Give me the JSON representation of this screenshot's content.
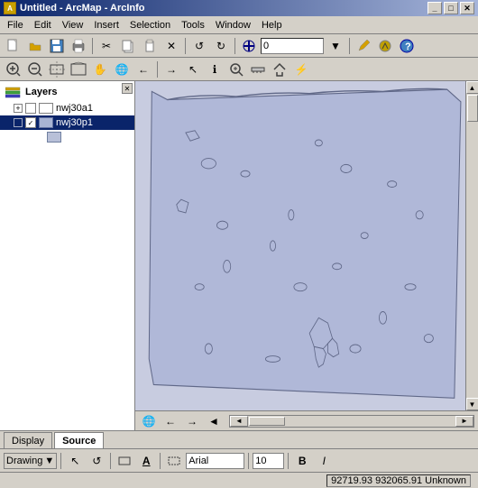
{
  "window": {
    "title": "Untitled - ArcMap - ArcInfo",
    "icon": "A"
  },
  "titlebar": {
    "buttons": {
      "minimize": "_",
      "maximize": "□",
      "close": "✕"
    }
  },
  "menubar": {
    "items": [
      {
        "label": "File",
        "id": "file"
      },
      {
        "label": "Edit",
        "id": "edit"
      },
      {
        "label": "View",
        "id": "view"
      },
      {
        "label": "Insert",
        "id": "insert"
      },
      {
        "label": "Selection",
        "id": "selection"
      },
      {
        "label": "Tools",
        "id": "tools"
      },
      {
        "label": "Window",
        "id": "window"
      },
      {
        "label": "Help",
        "id": "help"
      }
    ]
  },
  "toolbar1": {
    "zoom_value": "0"
  },
  "layers_panel": {
    "title": "Layers",
    "close_btn": "✕",
    "items": [
      {
        "name": "nwj30a1",
        "expanded": true,
        "checked": false,
        "indent": 0
      },
      {
        "name": "nwj30p1",
        "expanded": false,
        "checked": true,
        "indent": 0,
        "selected": true
      }
    ]
  },
  "bottom_tabs": {
    "display_label": "Display",
    "source_label": "Source"
  },
  "drawing_toolbar": {
    "drawing_label": "Drawing",
    "dropdown_arrow": "▼",
    "pointer_tool": "↖",
    "rotate_tool": "↺",
    "font_name": "Arial",
    "font_size": "10",
    "bold_label": "B",
    "italic_label": "I"
  },
  "status_bar": {
    "coordinates": "92719.93  932065.91 Unknown"
  },
  "map_icons": {
    "icons": [
      "🌐",
      "←",
      "→",
      "◄"
    ]
  },
  "icons": {
    "new": "📄",
    "open": "📂",
    "save": "💾",
    "print": "🖨",
    "cut": "✂",
    "copy": "📋",
    "paste": "📌",
    "delete": "✕",
    "undo": "↺",
    "redo": "↻",
    "add_data": "+",
    "zoom_in": "🔍",
    "zoom_out": "🔍",
    "pan": "✋",
    "identify": "ℹ",
    "find": "🔍",
    "measure": "📏",
    "lightning": "⚡",
    "globe": "🌐",
    "back": "←",
    "forward": "→",
    "select": "↖",
    "select_elements": "↗"
  }
}
